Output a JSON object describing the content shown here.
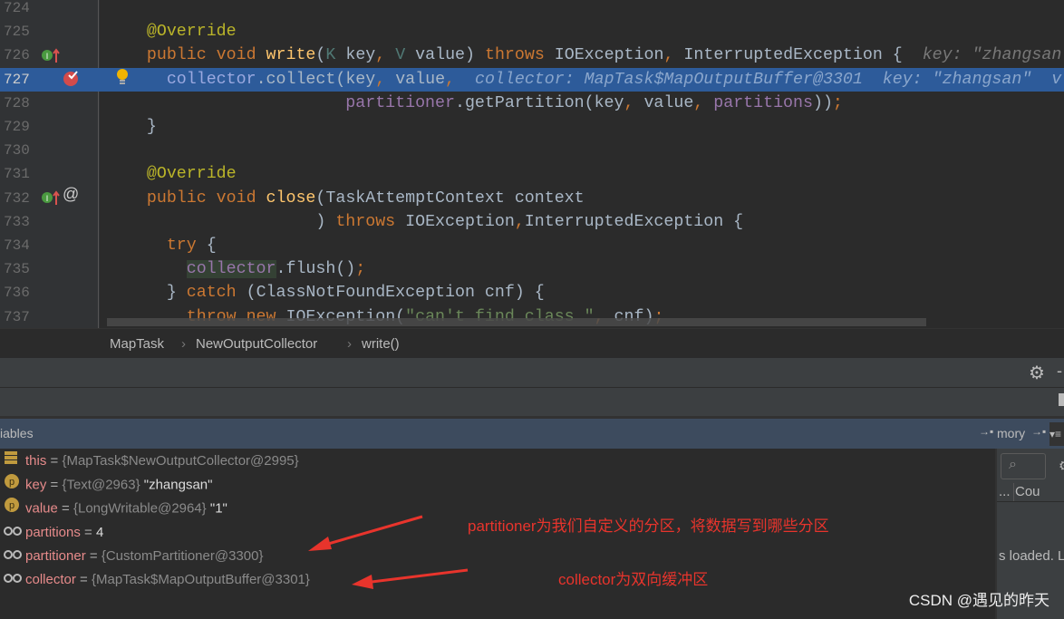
{
  "editor": {
    "lines": [
      {
        "n": "724",
        "tokens": []
      },
      {
        "n": "725",
        "tokens": [
          {
            "t": "    "
          },
          {
            "t": "@Override",
            "c": "ann"
          }
        ]
      },
      {
        "n": "726",
        "tokens": [
          {
            "t": "    "
          },
          {
            "t": "public void ",
            "c": "kw"
          },
          {
            "t": "write",
            "c": "fn"
          },
          {
            "t": "("
          },
          {
            "t": "K",
            "c": "tp"
          },
          {
            "t": " key"
          },
          {
            "t": ", ",
            "c": "kw"
          },
          {
            "t": "V",
            "c": "tp"
          },
          {
            "t": " value) "
          },
          {
            "t": "throws ",
            "c": "kw"
          },
          {
            "t": "IOException"
          },
          {
            "t": ", ",
            "c": "kw"
          },
          {
            "t": "InterruptedException {  "
          },
          {
            "t": "key: \"zhangsan\"",
            "c": "hint"
          }
        ]
      },
      {
        "n": "727",
        "current": true,
        "tokens": [
          {
            "t": "      "
          },
          {
            "t": "collector",
            "c": "fld"
          },
          {
            "t": ".collect(key"
          },
          {
            "t": ", ",
            "c": "kw"
          },
          {
            "t": "value"
          },
          {
            "t": ",  ",
            "c": "kw"
          },
          {
            "t": "collector: MapTask$MapOutputBuffer@3301  key: \"zhangsan\"  v",
            "c": "hint"
          }
        ]
      },
      {
        "n": "728",
        "tokens": [
          {
            "t": "                        "
          },
          {
            "t": "partitioner",
            "c": "fld"
          },
          {
            "t": ".getPartition(key"
          },
          {
            "t": ", ",
            "c": "kw"
          },
          {
            "t": "value"
          },
          {
            "t": ", ",
            "c": "kw"
          },
          {
            "t": "partitions",
            "c": "fld"
          },
          {
            "t": "))"
          },
          {
            "t": ";",
            "c": "kw"
          }
        ]
      },
      {
        "n": "729",
        "tokens": [
          {
            "t": "    }"
          }
        ]
      },
      {
        "n": "730",
        "tokens": []
      },
      {
        "n": "731",
        "tokens": [
          {
            "t": "    "
          },
          {
            "t": "@Override",
            "c": "ann"
          }
        ]
      },
      {
        "n": "732",
        "tokens": [
          {
            "t": "    "
          },
          {
            "t": "public void ",
            "c": "kw"
          },
          {
            "t": "close",
            "c": "fn"
          },
          {
            "t": "(TaskAttemptContext context"
          }
        ]
      },
      {
        "n": "733",
        "tokens": [
          {
            "t": "                     ) "
          },
          {
            "t": "throws ",
            "c": "kw"
          },
          {
            "t": "IOException"
          },
          {
            "t": ",",
            "c": "kw"
          },
          {
            "t": "InterruptedException {"
          }
        ]
      },
      {
        "n": "734",
        "tokens": [
          {
            "t": "      "
          },
          {
            "t": "try ",
            "c": "kw"
          },
          {
            "t": "{"
          }
        ]
      },
      {
        "n": "735",
        "tokens": [
          {
            "t": "        "
          },
          {
            "t": "collector",
            "c": "fld hl"
          },
          {
            "t": ".flush()"
          },
          {
            "t": ";",
            "c": "kw"
          }
        ]
      },
      {
        "n": "736",
        "tokens": [
          {
            "t": "      } "
          },
          {
            "t": "catch ",
            "c": "kw"
          },
          {
            "t": "(ClassNotFoundException cnf) {"
          }
        ]
      },
      {
        "n": "737",
        "tokens": [
          {
            "t": "        "
          },
          {
            "t": "throw new ",
            "c": "kw"
          },
          {
            "t": "IOException("
          },
          {
            "t": "\"can't find class \"",
            "c": "str"
          },
          {
            "t": ", ",
            "c": "kw"
          },
          {
            "t": "cnf)"
          },
          {
            "t": ";",
            "c": "kw"
          }
        ]
      }
    ]
  },
  "breadcrumb": [
    "MapTask",
    "NewOutputCollector",
    "write()"
  ],
  "variables_panel": {
    "title": "iables",
    "memory_tab": "mory",
    "items": [
      {
        "icon": "field-stack-icon",
        "name": "this",
        "type": "{MapTask$NewOutputCollector@2995}",
        "value": ""
      },
      {
        "icon": "parameter-icon",
        "name": "key",
        "type": "{Text@2963}",
        "value": "\"zhangsan\""
      },
      {
        "icon": "parameter-icon",
        "name": "value",
        "type": "{LongWritable@2964}",
        "value": "\"1\""
      },
      {
        "icon": "watch-glasses-icon",
        "name": "partitions",
        "type": "",
        "value": "4"
      },
      {
        "icon": "watch-glasses-icon",
        "name": "partitioner",
        "type": "{CustomPartitioner@3300}",
        "value": ""
      },
      {
        "icon": "watch-glasses-icon",
        "name": "collector",
        "type": "{MapTask$MapOutputBuffer@3301}",
        "value": ""
      }
    ]
  },
  "memory_panel": {
    "column": "Cou",
    "ellipsis": "...",
    "status": "s loaded. L"
  },
  "annotations": {
    "partitioner_note": "partitioner为我们自定义的分区，将数据写到哪些分区",
    "collector_note": "collector为双向缓冲区",
    "color": "#e8342c"
  },
  "watermark": "CSDN @遇见的昨天"
}
